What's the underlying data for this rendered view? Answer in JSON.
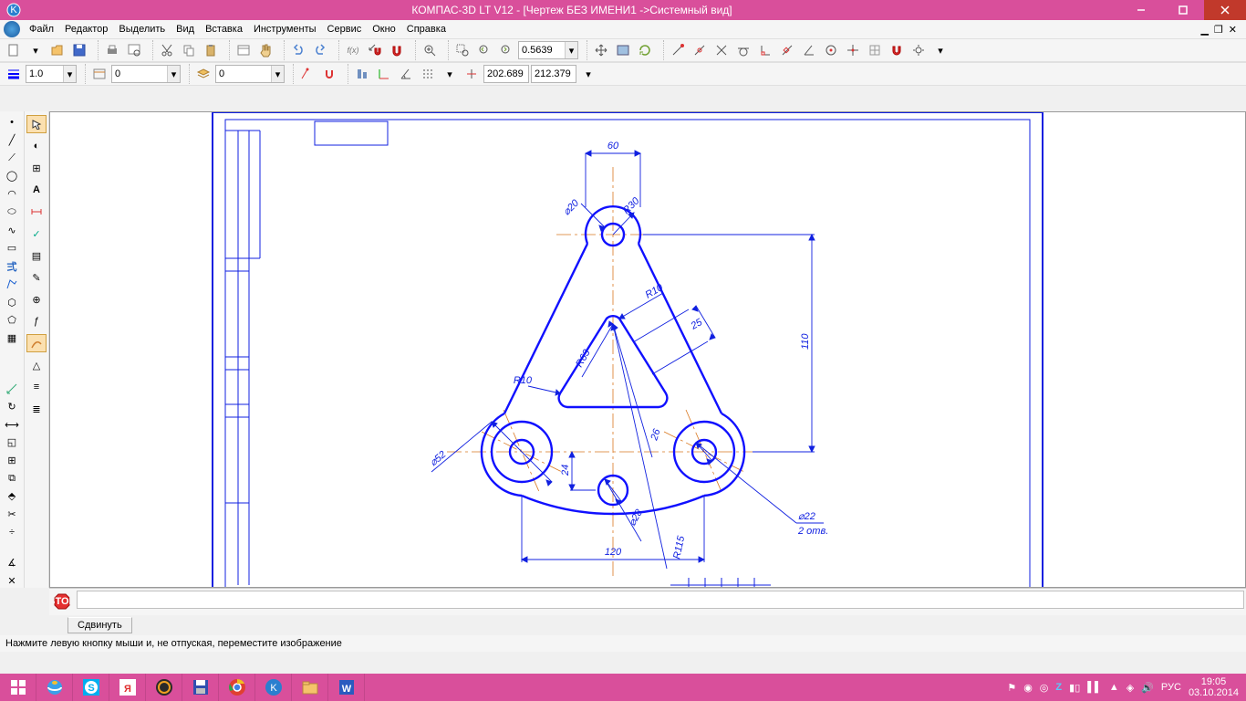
{
  "title": "КОМПАС-3D LT V12 - [Чертеж БЕЗ ИМЕНИ1 ->Системный вид]",
  "menu": {
    "file": "Файл",
    "editor": "Редактор",
    "select": "Выделить",
    "view": "Вид",
    "insert": "Вставка",
    "tools": "Инструменты",
    "service": "Сервис",
    "window": "Окно",
    "help": "Справка"
  },
  "topbar": {
    "zoom_value": "0.5639",
    "line_width": "1.0",
    "style_num": "0",
    "layer_num": "0",
    "coord_x": "202.689",
    "coord_y": "212.379"
  },
  "panel": {
    "tab": "Сдвинуть"
  },
  "hint": "Нажмите левую кнопку мыши и, не отпуская, переместите изображение",
  "tray": {
    "lang": "РУС",
    "time": "19:05",
    "date": "03.10.2014"
  },
  "drawing": {
    "dims": {
      "d60": "60",
      "d20": "⌀20",
      "r30": "R30",
      "r10a": "R10",
      "d25": "25",
      "d110": "110",
      "r63": "R63",
      "r10b": "R10",
      "d52": "⌀52",
      "d24": "24",
      "d26": "26",
      "d28": "⌀28",
      "d120": "120",
      "r115": "R115",
      "d22": "⌀22",
      "d22n": "2 отв."
    }
  }
}
